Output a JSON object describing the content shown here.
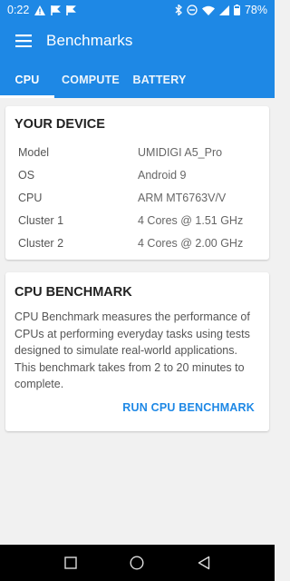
{
  "status_bar": {
    "time": "0:22",
    "battery": "78%"
  },
  "app_bar": {
    "title": "Benchmarks"
  },
  "tabs": [
    {
      "label": "CPU",
      "active": true
    },
    {
      "label": "COMPUTE",
      "active": false
    },
    {
      "label": "BATTERY",
      "active": false
    }
  ],
  "device": {
    "title": "YOUR DEVICE",
    "specs": [
      {
        "key": "Model",
        "value": "UMIDIGI A5_Pro"
      },
      {
        "key": "OS",
        "value": "Android 9"
      },
      {
        "key": "CPU",
        "value": "ARM MT6763V/V"
      },
      {
        "key": "Cluster 1",
        "value": "4 Cores @ 1.51 GHz"
      },
      {
        "key": "Cluster 2",
        "value": "4 Cores @ 2.00 GHz"
      }
    ]
  },
  "benchmark": {
    "title": "CPU BENCHMARK",
    "description": "CPU Benchmark measures the performance of CPUs at performing everyday tasks using tests designed to simulate real-world applications. This benchmark takes from 2 to 20 minutes to complete.",
    "button_label": "RUN CPU BENCHMARK"
  },
  "colors": {
    "primary": "#1e88e5",
    "background": "#f1f1f1"
  }
}
